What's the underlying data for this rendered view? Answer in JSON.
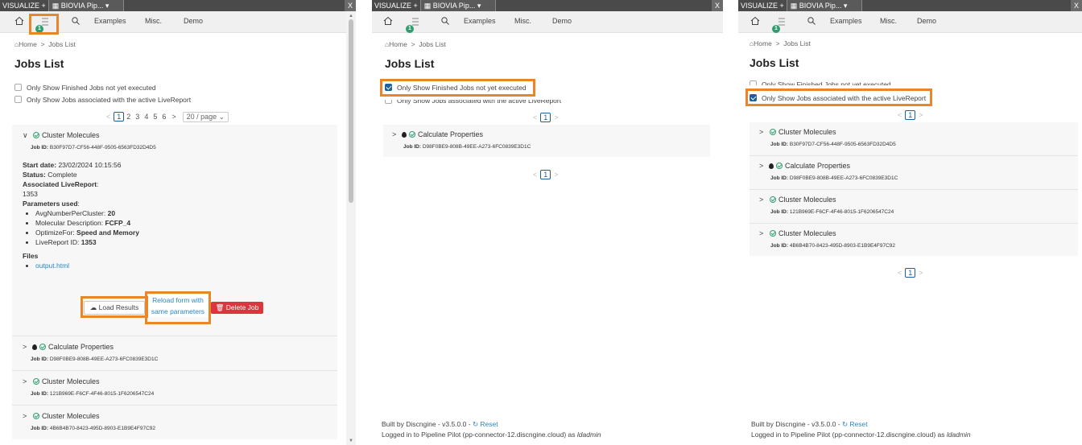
{
  "topbar": {
    "visualize_tab": "VISUALIZE +",
    "window_tab": "BIOVIA Pip...",
    "close": "X"
  },
  "nav": {
    "examples": "Examples",
    "misc": "Misc.",
    "demo": "Demo",
    "badge": "1"
  },
  "breadcrumb": {
    "home": "Home",
    "sep": ">",
    "current": "Jobs List"
  },
  "page_title": "Jobs List",
  "filters": {
    "finished": "Only Show Finished Jobs not yet executed",
    "active_lr": "Only Show Jobs associated with the active LiveReport"
  },
  "pager": {
    "pages": [
      "1",
      "2",
      "3",
      "4",
      "5",
      "6"
    ],
    "current": "1",
    "page_size": "20 / page",
    "prev": "<",
    "next": ">"
  },
  "jobs": [
    {
      "name": "Cluster Molecules",
      "id_label": "Job ID",
      "id": "B30F97D7-CF56-448F-9505-6563FD32D4D5"
    },
    {
      "name": "Calculate Properties",
      "id_label": "Job ID",
      "id": "D98F0BE9-808B-49EE-A273-6FC0839E3D1C"
    },
    {
      "name": "Cluster Molecules",
      "id_label": "Job ID",
      "id": "121B969E-F6CF-4F46-8015-1F6206547C24"
    },
    {
      "name": "Cluster Molecules",
      "id_label": "Job ID",
      "id": "4B6B4B70-8423-495D-8903-E1B9E4F97C92"
    }
  ],
  "details": {
    "start_label": "Start date",
    "start_value": "23/02/2024 10:15:56",
    "status_label": "Status",
    "status_value": "Complete",
    "lr_label": "Associated LiveReport",
    "lr_value": "1353",
    "params_label": "Parameters used",
    "params": [
      {
        "k": "AvgNumberPerCluster",
        "v": "20"
      },
      {
        "k": "Molecular Description",
        "v": "FCFP_4"
      },
      {
        "k": "OptimizeFor",
        "v": "Speed and Memory"
      },
      {
        "k": "LiveReport ID",
        "v": "1353"
      }
    ],
    "files_label": "Files",
    "file": "output.html"
  },
  "buttons": {
    "load": "Load Results",
    "reload_1": "Reload form with",
    "reload_2": "same parameters",
    "delete": "Delete Job"
  },
  "footer": {
    "built": "Built by Discngine - v3.5.0.0 -",
    "reset": "Reset",
    "logged": "Logged in to Pipeline Pilot (pp-connector-12.discngine.cloud) as",
    "user": "ldadmin"
  },
  "colors": {
    "accent": "#1d5f9c",
    "highlight": "#e8862a",
    "success": "#2e9e6e",
    "danger": "#d9363e",
    "link": "#2a86c5"
  }
}
